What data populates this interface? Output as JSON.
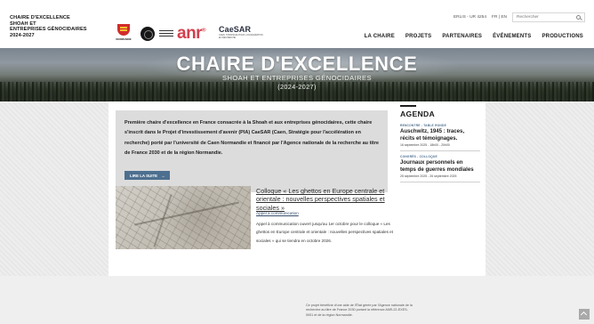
{
  "header": {
    "site_title_lines": [
      "CHAIRE D'EXCELLENCE",
      "SHOAH ET",
      "ENTREPRISES GÉNOCIDAIRES",
      "2024-2027"
    ],
    "top_link": "ERLIS - UR 4254",
    "lang": "FR | EN",
    "search_placeholder": "Rechercher",
    "search_icon": "search-icon",
    "nav": [
      "LA CHAIRE",
      "PROJETS",
      "PARTENAIRES",
      "ÉVÉNEMENTS",
      "PRODUCTIONS"
    ]
  },
  "hero": {
    "title": "CHAIRE D'EXCELLENCE",
    "subtitle": "SHOAH ET ENTREPRISES GÉNOCIDAIRES",
    "years": "(2024-2027)"
  },
  "intro": {
    "text": "Première chaire d'excellence en France consacrée à la Shoah et aux entreprises génocidaires, cette chaire s'inscrit dans le Projet d'investissement d'avenir (PIA) CaeSAR (Caen, Stratégie pour l'accélération en recherche) porté par l'université de Caen Normandie et financé par l'Agence nationale de la recherche au titre de France 2030 et de la région Normandie.",
    "button_label": "LIRE LA SUITE",
    "button_icon": "arrow-right-icon"
  },
  "news": {
    "title": "Colloque « Les ghettos en Europe centrale et orientale : nouvelles perspectives spatiales et sociales »",
    "category": "Appel à communication",
    "text": "Appel à communication ouvert jusqu'au 1er octobre pour le colloque « Les ghettos en Europe centrale et orientale : nouvelles perspectives spatiales et sociales » qui se tiendra en octobre 2026."
  },
  "agenda": {
    "heading": "AGENDA",
    "events": [
      {
        "category": "RENCONTRE - TABLE RONDE",
        "title": "Auschwitz, 1945 : traces, récits et témoignages.",
        "date": "16 septembre 2025 - 18h00 - 20h00"
      },
      {
        "category": "CONGRÈS - COLLOQUE",
        "title": "Journaux personnels en temps de guerres mondiales",
        "date": "25 septembre 2025 - 26 septembre 2025"
      }
    ]
  },
  "footer": {
    "logos": [
      "normandie-logo",
      "unicaen-logo",
      "mrsh-logo",
      "anr-logo",
      "caesar-logo"
    ],
    "normandie_word": "NORMANDIE",
    "anr_text": "anr",
    "anr_sup": "®",
    "caesar_text": "CaeSAR",
    "caesar_sub": "CAEN, STRATÉGIE POUR L'ACCÉLÉRATION EN RECHERCHE",
    "funding_text": "Ce projet bénéficie d'une aide de l'État gérée par l'Agence nationale de la recherche au titre de France 2030 portant la référence ANR-22-EXES-0001 et de la région Normandie.",
    "scroll_top_icon": "chevron-up-icon"
  },
  "colors": {
    "accent": "#4d6f8f",
    "anr_red": "#d2404f",
    "normandie_red": "#d12c2c",
    "intro_bg": "#dcdcdc"
  }
}
